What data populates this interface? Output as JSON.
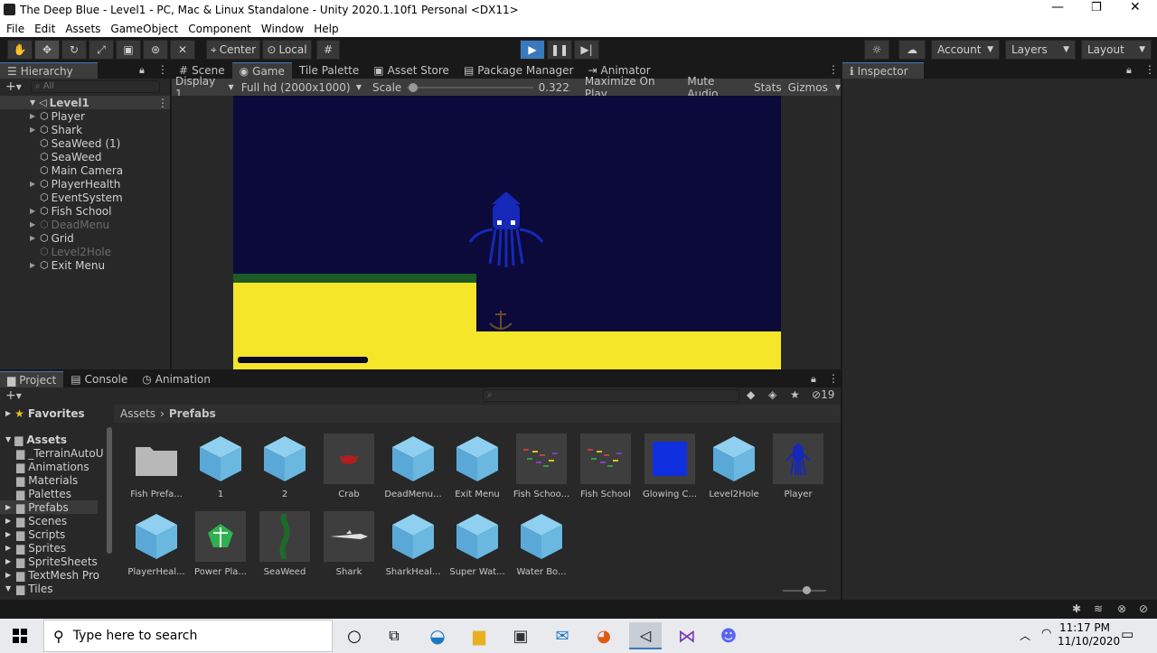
{
  "window": {
    "title": "The Deep Blue - Level1 - PC, Mac & Linux Standalone - Unity 2020.1.10f1 Personal <DX11>"
  },
  "menu": [
    "File",
    "Edit",
    "Assets",
    "GameObject",
    "Component",
    "Window",
    "Help"
  ],
  "toolbar": {
    "pivot_center": "Center",
    "pivot_local": "Local",
    "account": "Account",
    "layers": "Layers",
    "layout": "Layout"
  },
  "hierarchy": {
    "tab": "Hierarchy",
    "search_placeholder": "All",
    "scene": "Level1",
    "items": [
      {
        "label": "Player",
        "expandable": true,
        "active": true
      },
      {
        "label": "Shark",
        "expandable": true,
        "active": true
      },
      {
        "label": "SeaWeed (1)",
        "expandable": false,
        "active": true
      },
      {
        "label": "SeaWeed",
        "expandable": false,
        "active": true
      },
      {
        "label": "Main Camera",
        "expandable": false,
        "active": true
      },
      {
        "label": "PlayerHealth",
        "expandable": true,
        "active": true
      },
      {
        "label": "EventSystem",
        "expandable": false,
        "active": true
      },
      {
        "label": "Fish School",
        "expandable": true,
        "active": true
      },
      {
        "label": "DeadMenu",
        "expandable": true,
        "active": false
      },
      {
        "label": "Grid",
        "expandable": true,
        "active": true
      },
      {
        "label": "Level2Hole",
        "expandable": false,
        "active": false
      },
      {
        "label": "Exit Menu",
        "expandable": true,
        "active": true
      }
    ]
  },
  "center_tabs": [
    "Scene",
    "Game",
    "Tile Palette",
    "Asset Store",
    "Package Manager",
    "Animator"
  ],
  "game_bar": {
    "display": "Display 1",
    "resolution": "Full hd (2000x1000)",
    "scale_label": "Scale",
    "scale_value": "0.322x",
    "maximize": "Maximize On Play",
    "mute": "Mute Audio",
    "stats": "Stats",
    "gizmos": "Gizmos"
  },
  "game_view": {
    "health_fill": 1.0
  },
  "inspector": {
    "tab": "Inspector"
  },
  "bottom_tabs": [
    "Project",
    "Console",
    "Animation"
  ],
  "project": {
    "favorites": "Favorites",
    "assets_root": "Assets",
    "hidden_count": "19",
    "breadcrumb_root": "Assets",
    "breadcrumb_leaf": "Prefabs",
    "folders": [
      "_TerrainAutoU",
      "Animations",
      "Materials",
      "Palettes",
      "Prefabs",
      "Scenes",
      "Scripts",
      "Sprites",
      "SpriteSheets",
      "TextMesh Pro",
      "Tiles"
    ],
    "assets_row1": [
      "Fish Prefa...",
      "1",
      "2",
      "Crab",
      "DeadMenu...",
      "Exit Menu",
      "Fish Schoo...",
      "Fish School",
      "Glowing C...",
      "Level2Hole",
      "Player"
    ],
    "assets_row2": [
      "PlayerHeal...",
      "Power Pla...",
      "SeaWeed",
      "Shark",
      "SharkHeal...",
      "Super Wat...",
      "Water Bo..."
    ]
  },
  "taskbar": {
    "search_placeholder": "Type here to search",
    "time": "11:17 PM",
    "date": "11/10/2020"
  },
  "colors": {
    "accent": "#3a79bb",
    "game_bg": "#0b0a3a",
    "sand": "#f6e62a",
    "squid": "#1628b8",
    "cube": "#6ab8e0"
  }
}
